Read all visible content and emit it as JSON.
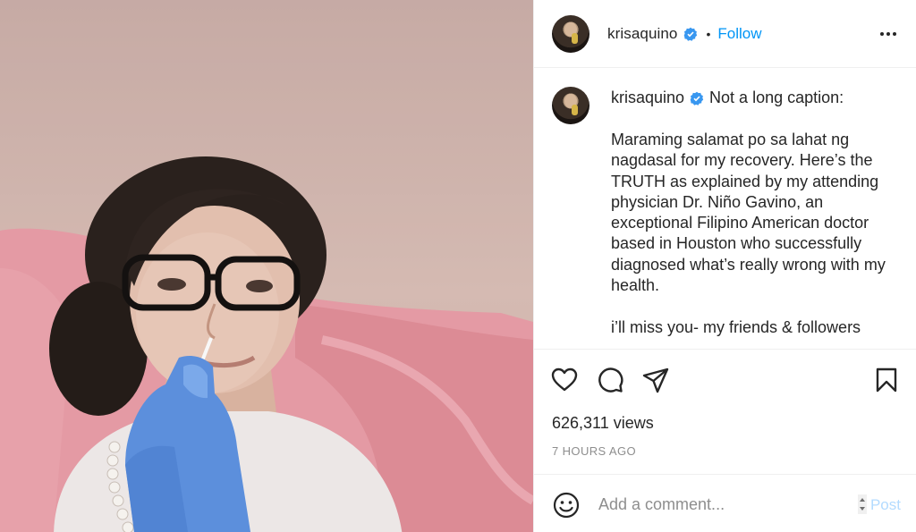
{
  "post": {
    "username": "krisaquino",
    "verified_icon": "verified-badge-icon",
    "follow_label": "Follow",
    "separator": "•",
    "more_icon": "more-options-icon"
  },
  "caption": {
    "username": "krisaquino",
    "lead": "Not a long caption:",
    "body": "Maraming salamat po sa lahat ng nagdasal for my recovery. Here’s the TRUTH as explained by my attending physician Dr. Niño Gavino, an exceptional Filipino American doctor based in Houston who successfully diagnosed what’s really wrong with my health.\n\ni’ll miss you- my friends & followers"
  },
  "actions": {
    "like_icon": "heart-icon",
    "comment_icon": "comment-bubble-icon",
    "share_icon": "paper-plane-icon",
    "save_icon": "bookmark-icon",
    "views": "626,311 views",
    "timestamp": "7 HOURS AGO"
  },
  "comment": {
    "emoji_icon": "emoji-icon",
    "placeholder": "Add a comment...",
    "post_label": "Post"
  },
  "colors": {
    "accent": "#0095f6",
    "post_disabled": "#b3dbff",
    "muted": "#8e8e8e",
    "border": "#efefef"
  }
}
